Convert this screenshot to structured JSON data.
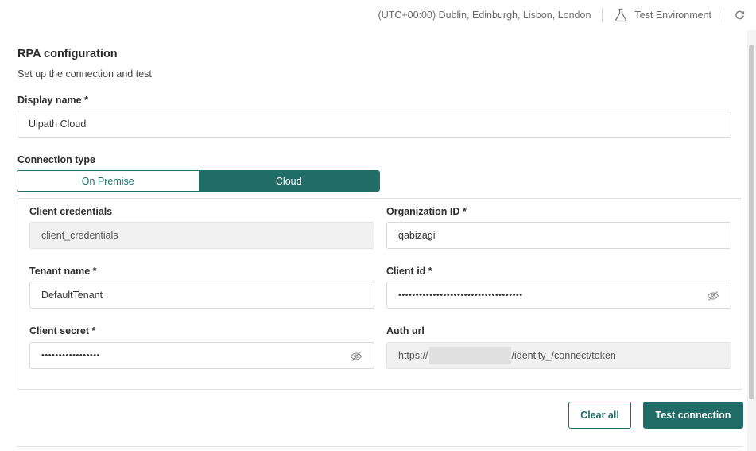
{
  "header": {
    "timezone": "(UTC+00:00) Dublin, Edinburgh, Lisbon, London",
    "environment": "Test Environment"
  },
  "page": {
    "title": "RPA configuration",
    "subtitle": "Set up the connection and test"
  },
  "form": {
    "display_name": {
      "label": "Display name *",
      "value": "Uipath Cloud"
    },
    "connection_type": {
      "label": "Connection type",
      "options": [
        "On Premise",
        "Cloud"
      ],
      "selected": "Cloud"
    },
    "client_credentials": {
      "label": "Client credentials",
      "value": "client_credentials"
    },
    "organization_id": {
      "label": "Organization ID *",
      "value": "qabizagi"
    },
    "tenant_name": {
      "label": "Tenant name *",
      "value": "DefaultTenant"
    },
    "client_id": {
      "label": "Client id *",
      "value": "••••••••••••••••••••••••••••••••••••"
    },
    "client_secret": {
      "label": "Client secret *",
      "value": "•••••••••••••••••"
    },
    "auth_url": {
      "label": "Auth url",
      "prefix": "https://",
      "suffix": "/identity_/connect/token"
    }
  },
  "actions": {
    "clear_label": "Clear all",
    "test_label": "Test connection"
  },
  "colors": {
    "accent": "#226c68",
    "readonly_bg": "#f1f1f1"
  }
}
